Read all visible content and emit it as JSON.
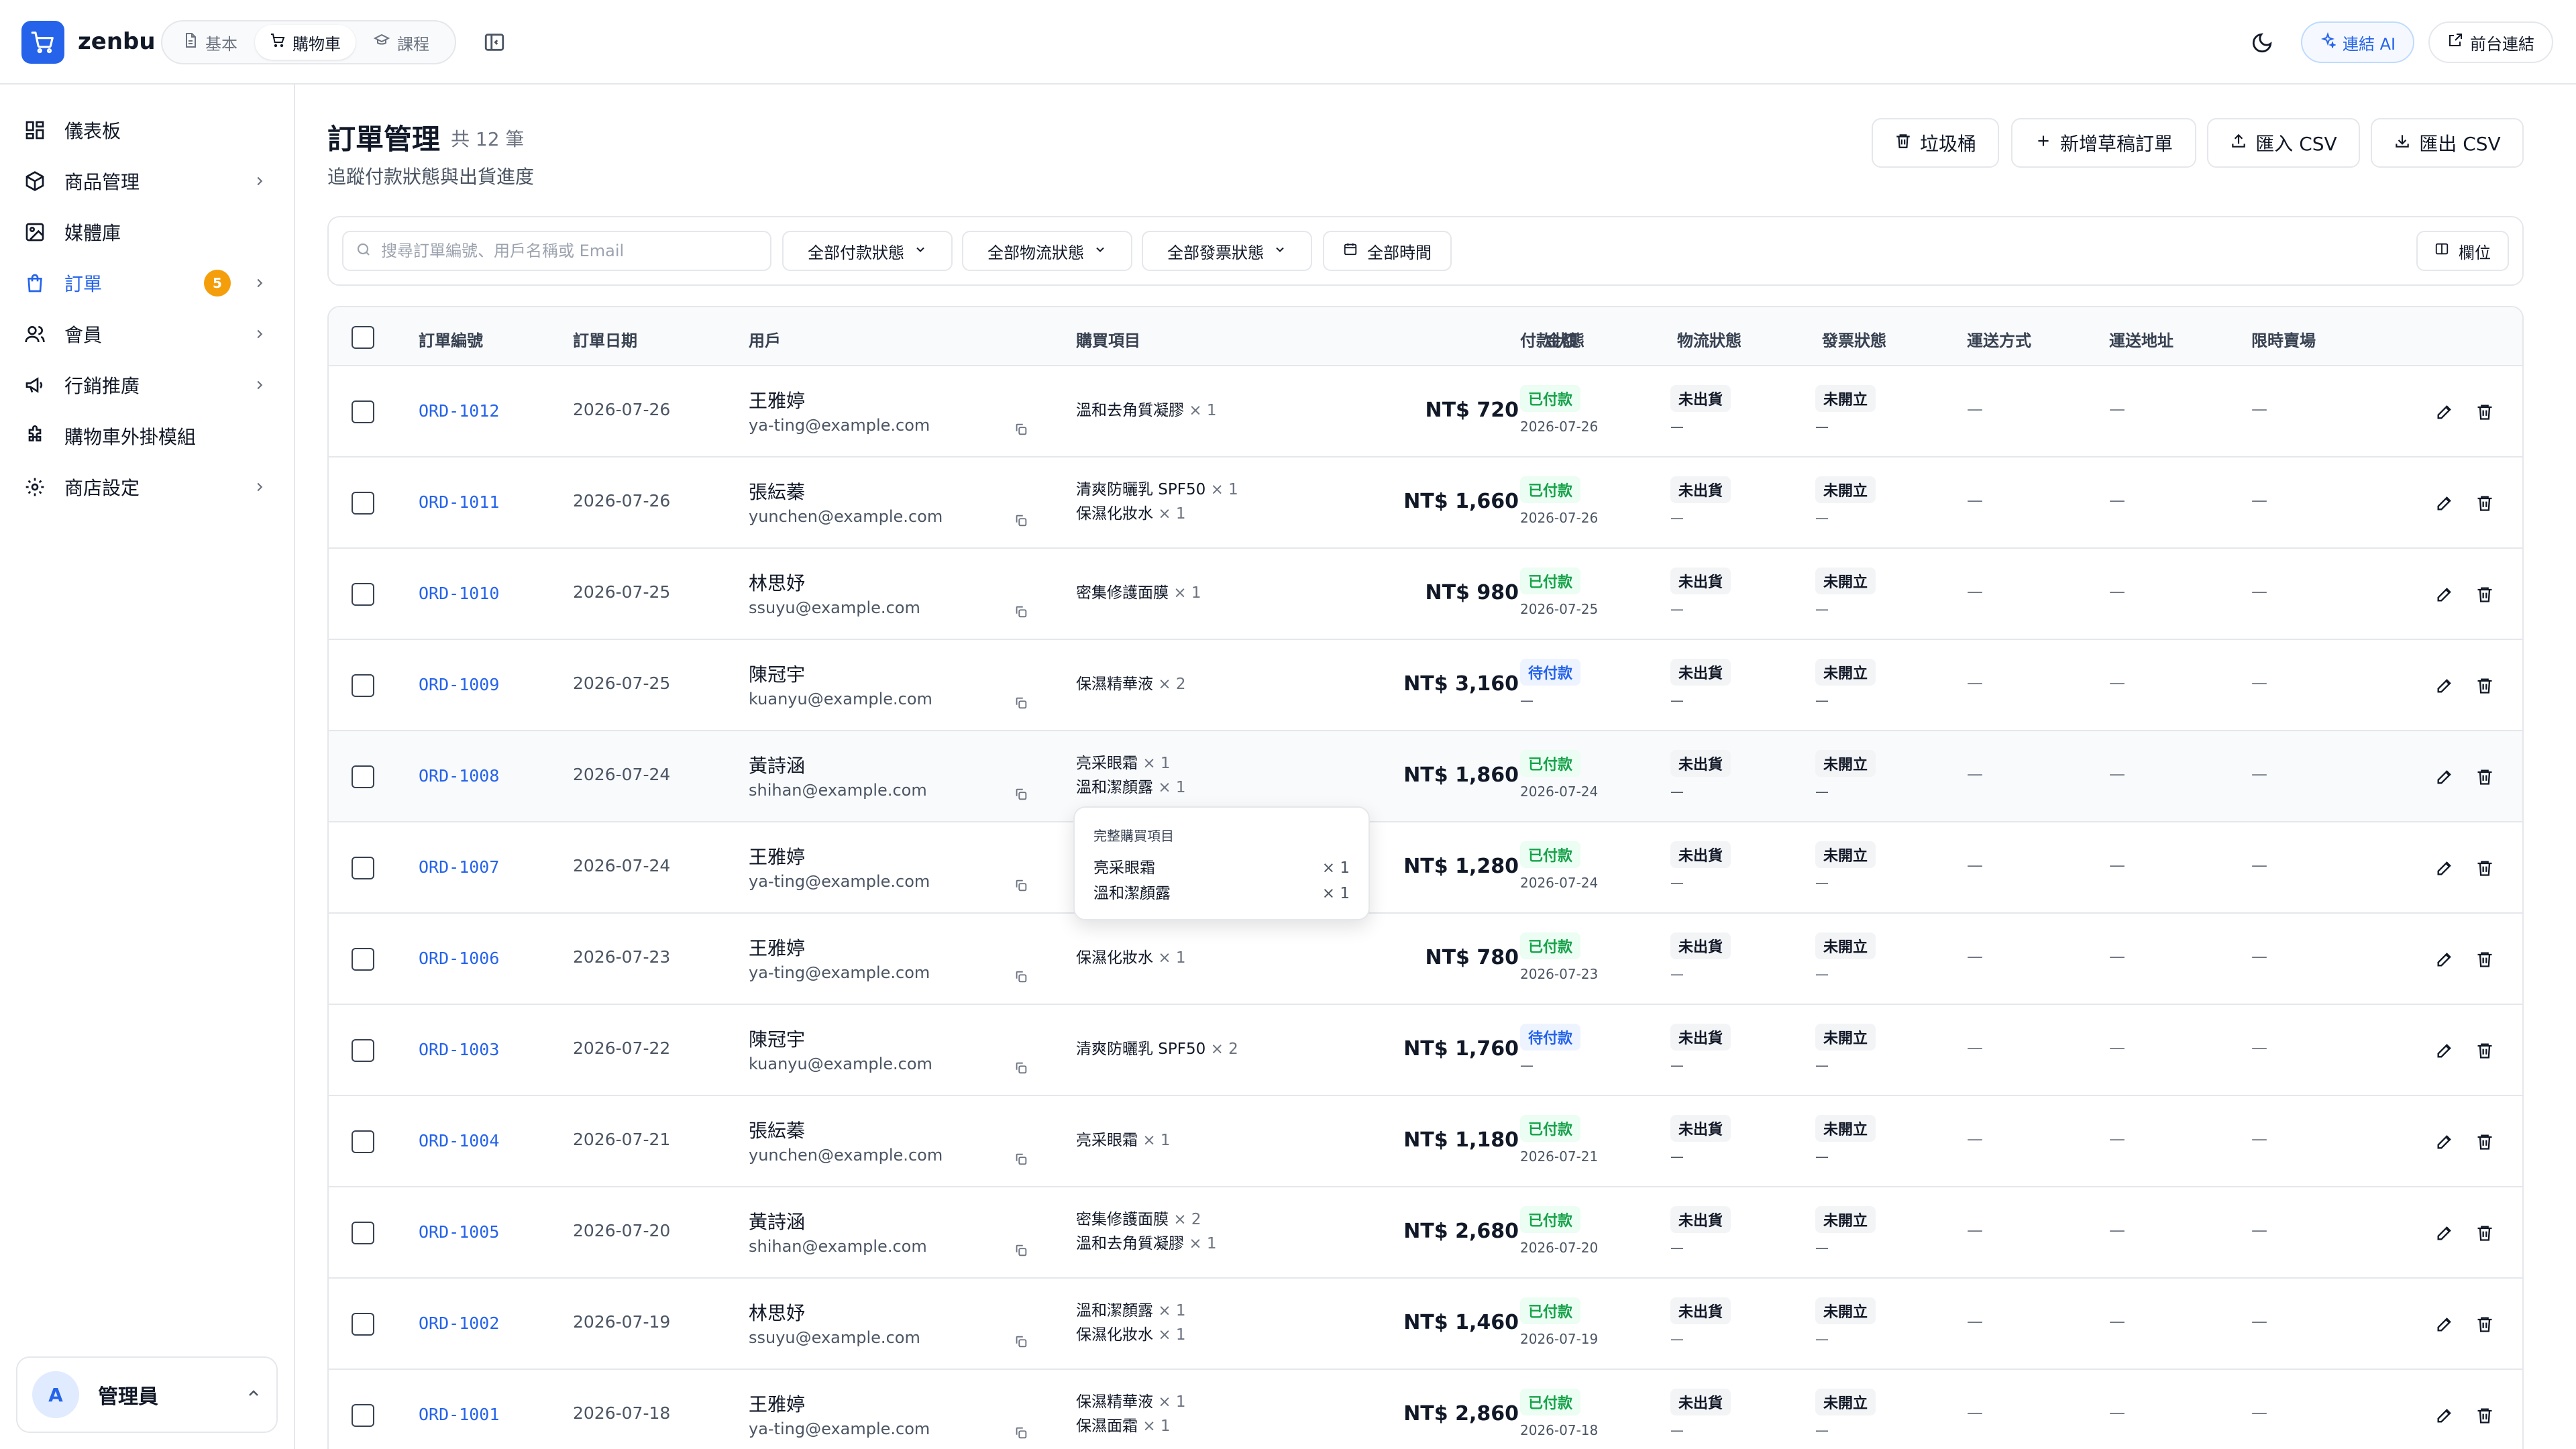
{
  "app": {
    "name": "zenbu"
  },
  "header": {
    "modes": [
      {
        "label": "基本",
        "icon": "document-icon"
      },
      {
        "label": "購物車",
        "icon": "cart-icon"
      },
      {
        "label": "課程",
        "icon": "graduation-cap-icon"
      }
    ],
    "active_mode": "購物車",
    "ai_label": "連結 AI",
    "frontend_label": "前台連結"
  },
  "sidebar": {
    "items": [
      {
        "label": "儀表板",
        "icon": "dashboard-icon"
      },
      {
        "label": "商品管理",
        "icon": "box-icon"
      },
      {
        "label": "媒體庫",
        "icon": "image-icon"
      },
      {
        "label": "訂單",
        "icon": "shopping-bag-icon",
        "badge": "5"
      },
      {
        "label": "會員",
        "icon": "users-icon"
      },
      {
        "label": "行銷推廣",
        "icon": "megaphone-icon"
      },
      {
        "label": "購物車外掛模組",
        "icon": "puzzle-icon"
      },
      {
        "label": "商店設定",
        "icon": "gear-icon"
      }
    ],
    "active": "訂單",
    "user": {
      "initial": "A",
      "name": "管理員"
    }
  },
  "page": {
    "title": "訂單管理",
    "count": "共 12 筆",
    "subtitle": "追蹤付款狀態與出貨進度",
    "actions": {
      "trash": "垃圾桶",
      "new_draft": "新增草稿訂單",
      "import_csv": "匯入 CSV",
      "export_csv": "匯出 CSV"
    }
  },
  "filters": {
    "search_placeholder": "搜尋訂單編號、用戶名稱或 Email",
    "search_value": "",
    "payment": "全部付款狀態",
    "shipping": "全部物流狀態",
    "invoice": "全部發票狀態",
    "time": "全部時間",
    "columns": "欄位"
  },
  "table": {
    "headers": {
      "order_no": "訂單編號",
      "order_date": "訂單日期",
      "user": "用戶",
      "items": "購買項目",
      "amount": "金額",
      "payment": "付款狀態",
      "shipping": "物流狀態",
      "invoice": "發票狀態",
      "ship_method": "運送方式",
      "ship_address": "運送地址",
      "flash_sale": "限時賣場"
    },
    "rows": [
      {
        "id": "ORD-1012",
        "date": "2026-07-26",
        "name": "王雅婷",
        "email": "ya-ting@example.com",
        "items": [
          {
            "name": "溫和去角質凝膠",
            "qty": "× 1"
          }
        ],
        "amount": "NT$ 720",
        "payment": "已付款",
        "payment_type": "paid",
        "payment_date": "2026-07-26",
        "shipping": "未出貨",
        "shipping_sub": "—",
        "invoice": "未開立",
        "invoice_sub": "—",
        "method": "—",
        "address": "—",
        "flash": "—"
      },
      {
        "id": "ORD-1011",
        "date": "2026-07-26",
        "name": "張紜蓁",
        "email": "yunchen@example.com",
        "items": [
          {
            "name": "清爽防曬乳 SPF50",
            "qty": "× 1"
          },
          {
            "name": "保濕化妝水",
            "qty": "× 1"
          }
        ],
        "amount": "NT$ 1,660",
        "payment": "已付款",
        "payment_type": "paid",
        "payment_date": "2026-07-26",
        "shipping": "未出貨",
        "shipping_sub": "—",
        "invoice": "未開立",
        "invoice_sub": "—",
        "method": "—",
        "address": "—",
        "flash": "—"
      },
      {
        "id": "ORD-1010",
        "date": "2026-07-25",
        "name": "林思妤",
        "email": "ssuyu@example.com",
        "items": [
          {
            "name": "密集修護面膜",
            "qty": "× 1"
          }
        ],
        "amount": "NT$ 980",
        "payment": "已付款",
        "payment_type": "paid",
        "payment_date": "2026-07-25",
        "shipping": "未出貨",
        "shipping_sub": "—",
        "invoice": "未開立",
        "invoice_sub": "—",
        "method": "—",
        "address": "—",
        "flash": "—"
      },
      {
        "id": "ORD-1009",
        "date": "2026-07-25",
        "name": "陳冠宇",
        "email": "kuanyu@example.com",
        "items": [
          {
            "name": "保濕精華液",
            "qty": "× 2"
          }
        ],
        "amount": "NT$ 3,160",
        "payment": "待付款",
        "payment_type": "pending",
        "payment_date": "—",
        "shipping": "未出貨",
        "shipping_sub": "—",
        "invoice": "未開立",
        "invoice_sub": "—",
        "method": "—",
        "address": "—",
        "flash": "—"
      },
      {
        "id": "ORD-1008",
        "date": "2026-07-24",
        "name": "黃詩涵",
        "email": "shihan@example.com",
        "items": [
          {
            "name": "亮采眼霜",
            "qty": "× 1"
          },
          {
            "name": "溫和潔顏露",
            "qty": "× 1"
          }
        ],
        "amount": "NT$ 1,860",
        "payment": "已付款",
        "payment_type": "paid",
        "payment_date": "2026-07-24",
        "shipping": "未出貨",
        "shipping_sub": "—",
        "invoice": "未開立",
        "invoice_sub": "—",
        "method": "—",
        "address": "—",
        "flash": "—"
      },
      {
        "id": "ORD-1007",
        "date": "2026-07-24",
        "name": "王雅婷",
        "email": "ya-ting@example.com",
        "items": [],
        "amount": "NT$ 1,280",
        "payment": "已付款",
        "payment_type": "paid",
        "payment_date": "2026-07-24",
        "shipping": "未出貨",
        "shipping_sub": "—",
        "invoice": "未開立",
        "invoice_sub": "—",
        "method": "—",
        "address": "—",
        "flash": "—"
      },
      {
        "id": "ORD-1006",
        "date": "2026-07-23",
        "name": "王雅婷",
        "email": "ya-ting@example.com",
        "items": [
          {
            "name": "保濕化妝水",
            "qty": "× 1"
          }
        ],
        "amount": "NT$ 780",
        "payment": "已付款",
        "payment_type": "paid",
        "payment_date": "2026-07-23",
        "shipping": "未出貨",
        "shipping_sub": "—",
        "invoice": "未開立",
        "invoice_sub": "—",
        "method": "—",
        "address": "—",
        "flash": "—"
      },
      {
        "id": "ORD-1003",
        "date": "2026-07-22",
        "name": "陳冠宇",
        "email": "kuanyu@example.com",
        "items": [
          {
            "name": "清爽防曬乳 SPF50",
            "qty": "× 2"
          }
        ],
        "amount": "NT$ 1,760",
        "payment": "待付款",
        "payment_type": "pending",
        "payment_date": "—",
        "shipping": "未出貨",
        "shipping_sub": "—",
        "invoice": "未開立",
        "invoice_sub": "—",
        "method": "—",
        "address": "—",
        "flash": "—"
      },
      {
        "id": "ORD-1004",
        "date": "2026-07-21",
        "name": "張紜蓁",
        "email": "yunchen@example.com",
        "items": [
          {
            "name": "亮采眼霜",
            "qty": "× 1"
          }
        ],
        "amount": "NT$ 1,180",
        "payment": "已付款",
        "payment_type": "paid",
        "payment_date": "2026-07-21",
        "shipping": "未出貨",
        "shipping_sub": "—",
        "invoice": "未開立",
        "invoice_sub": "—",
        "method": "—",
        "address": "—",
        "flash": "—"
      },
      {
        "id": "ORD-1005",
        "date": "2026-07-20",
        "name": "黃詩涵",
        "email": "shihan@example.com",
        "items": [
          {
            "name": "密集修護面膜",
            "qty": "× 2"
          },
          {
            "name": "溫和去角質凝膠",
            "qty": "× 1"
          }
        ],
        "amount": "NT$ 2,680",
        "payment": "已付款",
        "payment_type": "paid",
        "payment_date": "2026-07-20",
        "shipping": "未出貨",
        "shipping_sub": "—",
        "invoice": "未開立",
        "invoice_sub": "—",
        "method": "—",
        "address": "—",
        "flash": "—"
      },
      {
        "id": "ORD-1002",
        "date": "2026-07-19",
        "name": "林思妤",
        "email": "ssuyu@example.com",
        "items": [
          {
            "name": "溫和潔顏露",
            "qty": "× 1"
          },
          {
            "name": "保濕化妝水",
            "qty": "× 1"
          }
        ],
        "amount": "NT$ 1,460",
        "payment": "已付款",
        "payment_type": "paid",
        "payment_date": "2026-07-19",
        "shipping": "未出貨",
        "shipping_sub": "—",
        "invoice": "未開立",
        "invoice_sub": "—",
        "method": "—",
        "address": "—",
        "flash": "—"
      },
      {
        "id": "ORD-1001",
        "date": "2026-07-18",
        "name": "王雅婷",
        "email": "ya-ting@example.com",
        "items": [
          {
            "name": "保濕精華液",
            "qty": "× 1"
          },
          {
            "name": "保濕面霜",
            "qty": "× 1"
          }
        ],
        "amount": "NT$ 2,860",
        "payment": "已付款",
        "payment_type": "paid",
        "payment_date": "2026-07-18",
        "shipping": "未出貨",
        "shipping_sub": "—",
        "invoice": "未開立",
        "invoice_sub": "—",
        "method": "—",
        "address": "—",
        "flash": "—"
      }
    ],
    "hover_row": 4
  },
  "popover": {
    "title": "完整購買項目",
    "items": [
      {
        "name": "亮采眼霜",
        "qty": "× 1"
      },
      {
        "name": "溫和潔顏露",
        "qty": "× 1"
      }
    ]
  },
  "colors": {
    "accent": "#2563eb",
    "badge": "#f59e0b",
    "paid": "#16a34a",
    "pending": "#2563eb",
    "border": "#e5e7eb"
  }
}
